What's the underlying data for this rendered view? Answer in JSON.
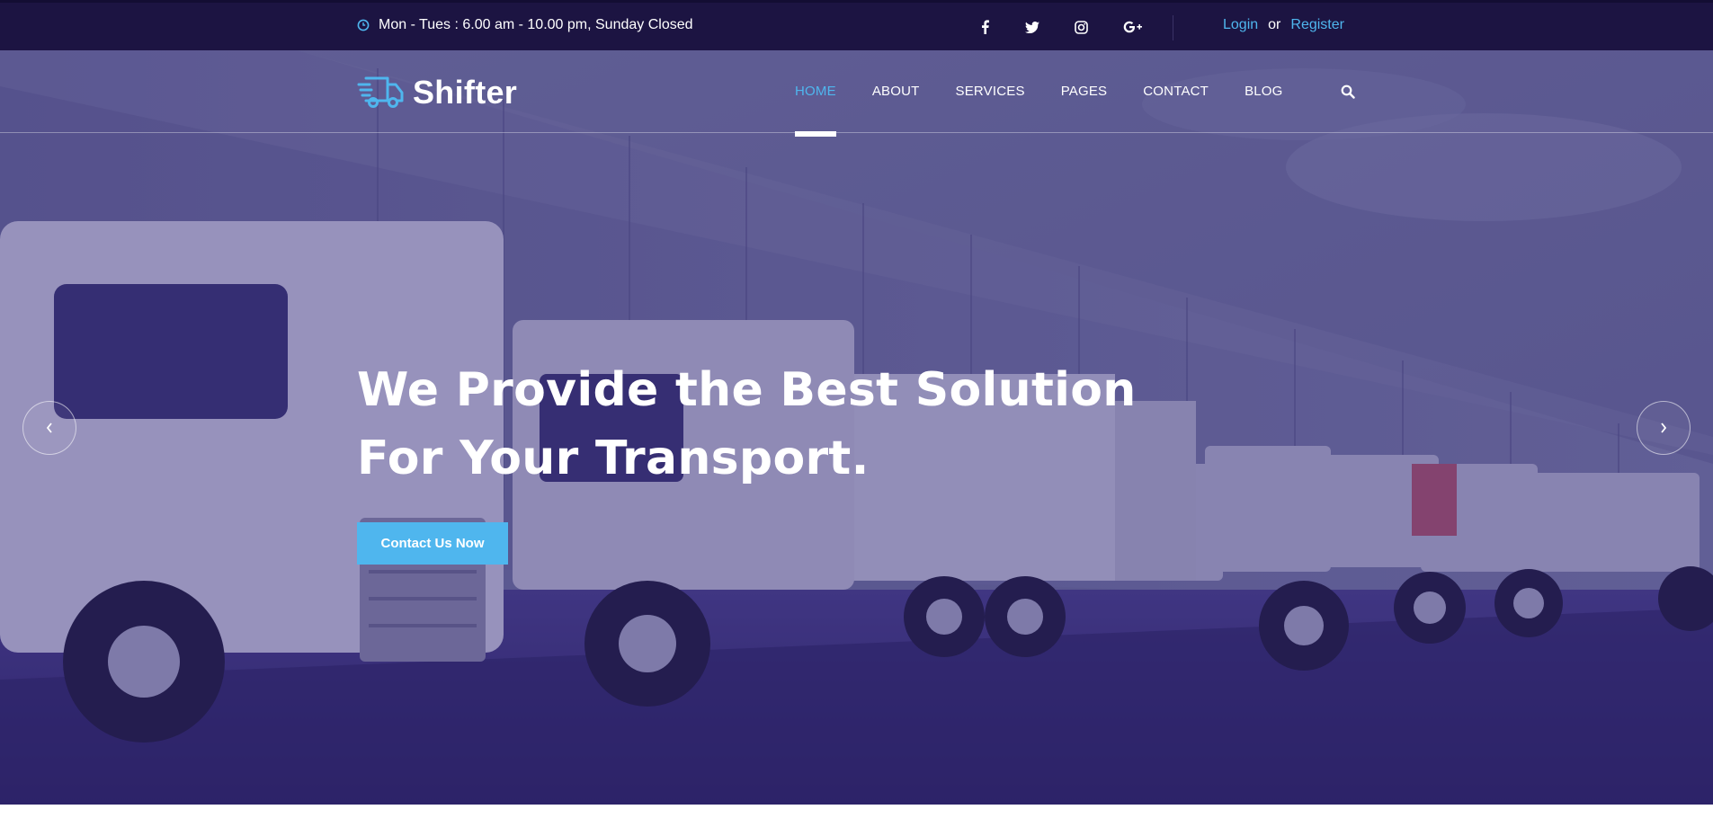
{
  "topbar": {
    "hours_icon": "clock-icon",
    "hours_text": "Mon - Tues : 6.00 am - 10.00 pm, Sunday Closed",
    "social": [
      {
        "icon": "facebook-icon"
      },
      {
        "icon": "twitter-icon"
      },
      {
        "icon": "instagram-icon"
      },
      {
        "icon": "google-plus-icon"
      }
    ],
    "login_label": "Login",
    "or_label": "or",
    "register_label": "Register"
  },
  "header": {
    "logo_icon": "delivery-truck-icon",
    "logo_text": "Shifter",
    "nav": [
      {
        "label": "HOME",
        "active": true
      },
      {
        "label": "ABOUT"
      },
      {
        "label": "SERVICES"
      },
      {
        "label": "PAGES"
      },
      {
        "label": "CONTACT"
      },
      {
        "label": "BLOG"
      }
    ],
    "search_icon": "search-icon"
  },
  "hero": {
    "headline_line1": "We Provide the Best Solution",
    "headline_line2": "For Your Transport.",
    "cta_label": "Contact Us Now",
    "prev_icon": "chevron-left-icon",
    "next_icon": "chevron-right-icon"
  },
  "colors": {
    "topbar_bg": "#1c1442",
    "accent": "#4fb6ee",
    "hero_overlay": "#2c2360"
  }
}
